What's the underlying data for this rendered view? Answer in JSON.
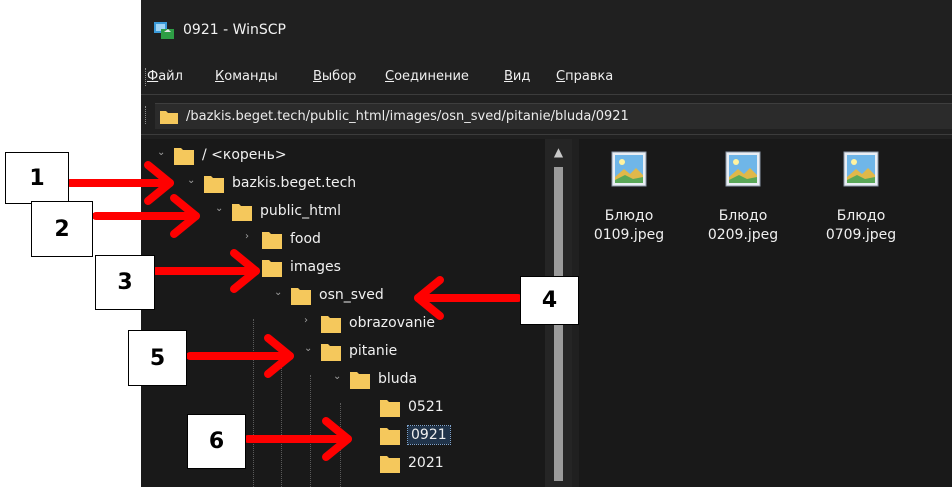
{
  "window": {
    "title": "0921 - WinSCP"
  },
  "menu": [
    {
      "text": "Файл",
      "u": 0
    },
    {
      "text": "Команды",
      "u": 0
    },
    {
      "text": "Выбор",
      "u": 0
    },
    {
      "text": "Соединение",
      "u": 0
    },
    {
      "text": "Вид",
      "u": 0
    },
    {
      "text": "Справка",
      "u": 0
    }
  ],
  "address": {
    "path": "/bazkis.beget.tech/public_html/images/osn_sved/pitanie/bluda/0921"
  },
  "tree": [
    {
      "label": "/ <корень>",
      "chevron": "down"
    },
    {
      "label": "bazkis.beget.tech",
      "chevron": "down"
    },
    {
      "label": "public_html",
      "chevron": "down"
    },
    {
      "label": "food",
      "chevron": "right"
    },
    {
      "label": "images",
      "chevron": "down"
    },
    {
      "label": "osn_sved",
      "chevron": "down"
    },
    {
      "label": "obrazovanie",
      "chevron": "right"
    },
    {
      "label": "pitanie",
      "chevron": "down"
    },
    {
      "label": "bluda",
      "chevron": "down"
    },
    {
      "label": "0521",
      "chevron": ""
    },
    {
      "label": "0921",
      "chevron": "",
      "selected": true
    },
    {
      "label": "2021",
      "chevron": ""
    }
  ],
  "files": [
    {
      "line1": "Блюдо",
      "line2": "0109.jpeg"
    },
    {
      "line1": "Блюдо",
      "line2": "0209.jpeg"
    },
    {
      "line1": "Блюдо",
      "line2": "0709.jpeg"
    }
  ],
  "callouts": [
    "1",
    "2",
    "3",
    "4",
    "5",
    "6"
  ],
  "colors": {
    "arrow": "#ff0000",
    "folder": "#f5c85c",
    "selection": "#21344a",
    "window_bg": "#202020",
    "pane_bg": "#191919"
  },
  "icons": {
    "app": "winscp-icon",
    "folder": "folder-icon",
    "file": "image-file-icon",
    "scroll_up": "chevron-up-icon"
  }
}
